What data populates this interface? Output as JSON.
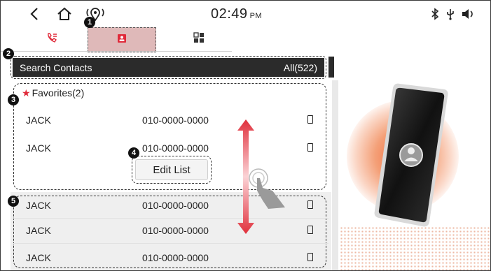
{
  "status_bar": {
    "time": "02:49",
    "ampm": "PM"
  },
  "tabs": [
    {
      "name": "call-history",
      "icon": "call-log-icon"
    },
    {
      "name": "contacts",
      "icon": "contacts-icon",
      "selected": true
    },
    {
      "name": "keypad",
      "icon": "keypad-icon"
    }
  ],
  "search": {
    "label": "Search Contacts",
    "count": "All(522)"
  },
  "favorites": {
    "title": "Favorites(2)",
    "rows": [
      {
        "name": "JACK",
        "number": "010-0000-0000"
      },
      {
        "name": "JACK",
        "number": "010-0000-0000"
      }
    ],
    "edit_label": "Edit List"
  },
  "contacts": {
    "rows": [
      {
        "name": "JACK",
        "number": "010-0000-0000"
      },
      {
        "name": "JACK",
        "number": "010-0000-0000"
      },
      {
        "name": "JACK",
        "number": "010-0000-0000"
      }
    ]
  },
  "callouts": [
    "1",
    "2",
    "3",
    "4",
    "5"
  ],
  "colors": {
    "accent_red": "#e02a3a",
    "selected_tab": "#dfb9b9",
    "search_bar": "#2b2b2b"
  }
}
